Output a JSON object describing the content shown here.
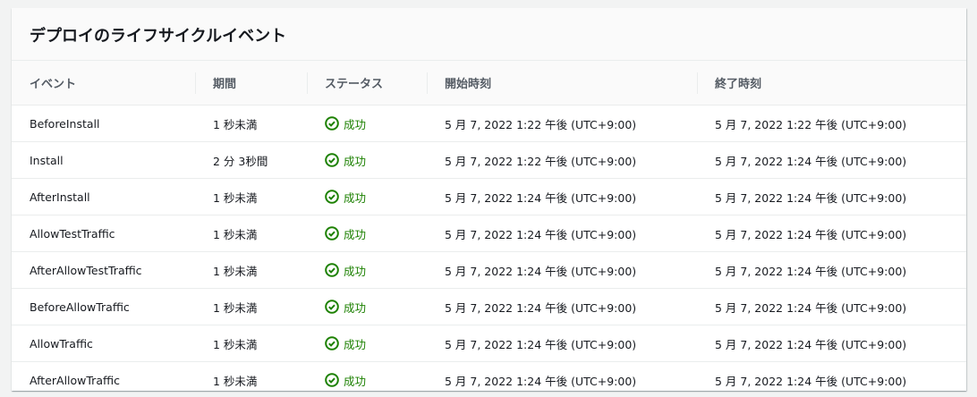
{
  "title": "デプロイのライフサイクルイベント",
  "columns": [
    "イベント",
    "期間",
    "ステータス",
    "開始時刻",
    "終了時刻"
  ],
  "colors": {
    "success": "#1d8102"
  },
  "rows": [
    {
      "event": "BeforeInstall",
      "duration": "1 秒未満",
      "status": "成功",
      "start": "5 月 7, 2022 1:22 午後 (UTC+9:00)",
      "end": "5 月 7, 2022 1:22 午後 (UTC+9:00)"
    },
    {
      "event": "Install",
      "duration": "2 分 3秒間",
      "status": "成功",
      "start": "5 月 7, 2022 1:22 午後 (UTC+9:00)",
      "end": "5 月 7, 2022 1:24 午後 (UTC+9:00)"
    },
    {
      "event": "AfterInstall",
      "duration": "1 秒未満",
      "status": "成功",
      "start": "5 月 7, 2022 1:24 午後 (UTC+9:00)",
      "end": "5 月 7, 2022 1:24 午後 (UTC+9:00)"
    },
    {
      "event": "AllowTestTraffic",
      "duration": "1 秒未満",
      "status": "成功",
      "start": "5 月 7, 2022 1:24 午後 (UTC+9:00)",
      "end": "5 月 7, 2022 1:24 午後 (UTC+9:00)"
    },
    {
      "event": "AfterAllowTestTraffic",
      "duration": "1 秒未満",
      "status": "成功",
      "start": "5 月 7, 2022 1:24 午後 (UTC+9:00)",
      "end": "5 月 7, 2022 1:24 午後 (UTC+9:00)"
    },
    {
      "event": "BeforeAllowTraffic",
      "duration": "1 秒未満",
      "status": "成功",
      "start": "5 月 7, 2022 1:24 午後 (UTC+9:00)",
      "end": "5 月 7, 2022 1:24 午後 (UTC+9:00)"
    },
    {
      "event": "AllowTraffic",
      "duration": "1 秒未満",
      "status": "成功",
      "start": "5 月 7, 2022 1:24 午後 (UTC+9:00)",
      "end": "5 月 7, 2022 1:24 午後 (UTC+9:00)"
    },
    {
      "event": "AfterAllowTraffic",
      "duration": "1 秒未満",
      "status": "成功",
      "start": "5 月 7, 2022 1:24 午後 (UTC+9:00)",
      "end": "5 月 7, 2022 1:24 午後 (UTC+9:00)"
    }
  ]
}
